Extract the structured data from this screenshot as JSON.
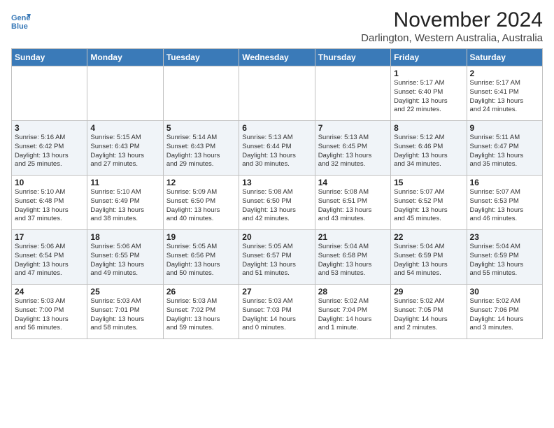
{
  "logo": {
    "line1": "General",
    "line2": "Blue"
  },
  "title": "November 2024",
  "location": "Darlington, Western Australia, Australia",
  "weekdays": [
    "Sunday",
    "Monday",
    "Tuesday",
    "Wednesday",
    "Thursday",
    "Friday",
    "Saturday"
  ],
  "weeks": [
    [
      {
        "day": "",
        "info": ""
      },
      {
        "day": "",
        "info": ""
      },
      {
        "day": "",
        "info": ""
      },
      {
        "day": "",
        "info": ""
      },
      {
        "day": "",
        "info": ""
      },
      {
        "day": "1",
        "info": "Sunrise: 5:17 AM\nSunset: 6:40 PM\nDaylight: 13 hours\nand 22 minutes."
      },
      {
        "day": "2",
        "info": "Sunrise: 5:17 AM\nSunset: 6:41 PM\nDaylight: 13 hours\nand 24 minutes."
      }
    ],
    [
      {
        "day": "3",
        "info": "Sunrise: 5:16 AM\nSunset: 6:42 PM\nDaylight: 13 hours\nand 25 minutes."
      },
      {
        "day": "4",
        "info": "Sunrise: 5:15 AM\nSunset: 6:43 PM\nDaylight: 13 hours\nand 27 minutes."
      },
      {
        "day": "5",
        "info": "Sunrise: 5:14 AM\nSunset: 6:43 PM\nDaylight: 13 hours\nand 29 minutes."
      },
      {
        "day": "6",
        "info": "Sunrise: 5:13 AM\nSunset: 6:44 PM\nDaylight: 13 hours\nand 30 minutes."
      },
      {
        "day": "7",
        "info": "Sunrise: 5:13 AM\nSunset: 6:45 PM\nDaylight: 13 hours\nand 32 minutes."
      },
      {
        "day": "8",
        "info": "Sunrise: 5:12 AM\nSunset: 6:46 PM\nDaylight: 13 hours\nand 34 minutes."
      },
      {
        "day": "9",
        "info": "Sunrise: 5:11 AM\nSunset: 6:47 PM\nDaylight: 13 hours\nand 35 minutes."
      }
    ],
    [
      {
        "day": "10",
        "info": "Sunrise: 5:10 AM\nSunset: 6:48 PM\nDaylight: 13 hours\nand 37 minutes."
      },
      {
        "day": "11",
        "info": "Sunrise: 5:10 AM\nSunset: 6:49 PM\nDaylight: 13 hours\nand 38 minutes."
      },
      {
        "day": "12",
        "info": "Sunrise: 5:09 AM\nSunset: 6:50 PM\nDaylight: 13 hours\nand 40 minutes."
      },
      {
        "day": "13",
        "info": "Sunrise: 5:08 AM\nSunset: 6:50 PM\nDaylight: 13 hours\nand 42 minutes."
      },
      {
        "day": "14",
        "info": "Sunrise: 5:08 AM\nSunset: 6:51 PM\nDaylight: 13 hours\nand 43 minutes."
      },
      {
        "day": "15",
        "info": "Sunrise: 5:07 AM\nSunset: 6:52 PM\nDaylight: 13 hours\nand 45 minutes."
      },
      {
        "day": "16",
        "info": "Sunrise: 5:07 AM\nSunset: 6:53 PM\nDaylight: 13 hours\nand 46 minutes."
      }
    ],
    [
      {
        "day": "17",
        "info": "Sunrise: 5:06 AM\nSunset: 6:54 PM\nDaylight: 13 hours\nand 47 minutes."
      },
      {
        "day": "18",
        "info": "Sunrise: 5:06 AM\nSunset: 6:55 PM\nDaylight: 13 hours\nand 49 minutes."
      },
      {
        "day": "19",
        "info": "Sunrise: 5:05 AM\nSunset: 6:56 PM\nDaylight: 13 hours\nand 50 minutes."
      },
      {
        "day": "20",
        "info": "Sunrise: 5:05 AM\nSunset: 6:57 PM\nDaylight: 13 hours\nand 51 minutes."
      },
      {
        "day": "21",
        "info": "Sunrise: 5:04 AM\nSunset: 6:58 PM\nDaylight: 13 hours\nand 53 minutes."
      },
      {
        "day": "22",
        "info": "Sunrise: 5:04 AM\nSunset: 6:59 PM\nDaylight: 13 hours\nand 54 minutes."
      },
      {
        "day": "23",
        "info": "Sunrise: 5:04 AM\nSunset: 6:59 PM\nDaylight: 13 hours\nand 55 minutes."
      }
    ],
    [
      {
        "day": "24",
        "info": "Sunrise: 5:03 AM\nSunset: 7:00 PM\nDaylight: 13 hours\nand 56 minutes."
      },
      {
        "day": "25",
        "info": "Sunrise: 5:03 AM\nSunset: 7:01 PM\nDaylight: 13 hours\nand 58 minutes."
      },
      {
        "day": "26",
        "info": "Sunrise: 5:03 AM\nSunset: 7:02 PM\nDaylight: 13 hours\nand 59 minutes."
      },
      {
        "day": "27",
        "info": "Sunrise: 5:03 AM\nSunset: 7:03 PM\nDaylight: 14 hours\nand 0 minutes."
      },
      {
        "day": "28",
        "info": "Sunrise: 5:02 AM\nSunset: 7:04 PM\nDaylight: 14 hours\nand 1 minute."
      },
      {
        "day": "29",
        "info": "Sunrise: 5:02 AM\nSunset: 7:05 PM\nDaylight: 14 hours\nand 2 minutes."
      },
      {
        "day": "30",
        "info": "Sunrise: 5:02 AM\nSunset: 7:06 PM\nDaylight: 14 hours\nand 3 minutes."
      }
    ]
  ]
}
